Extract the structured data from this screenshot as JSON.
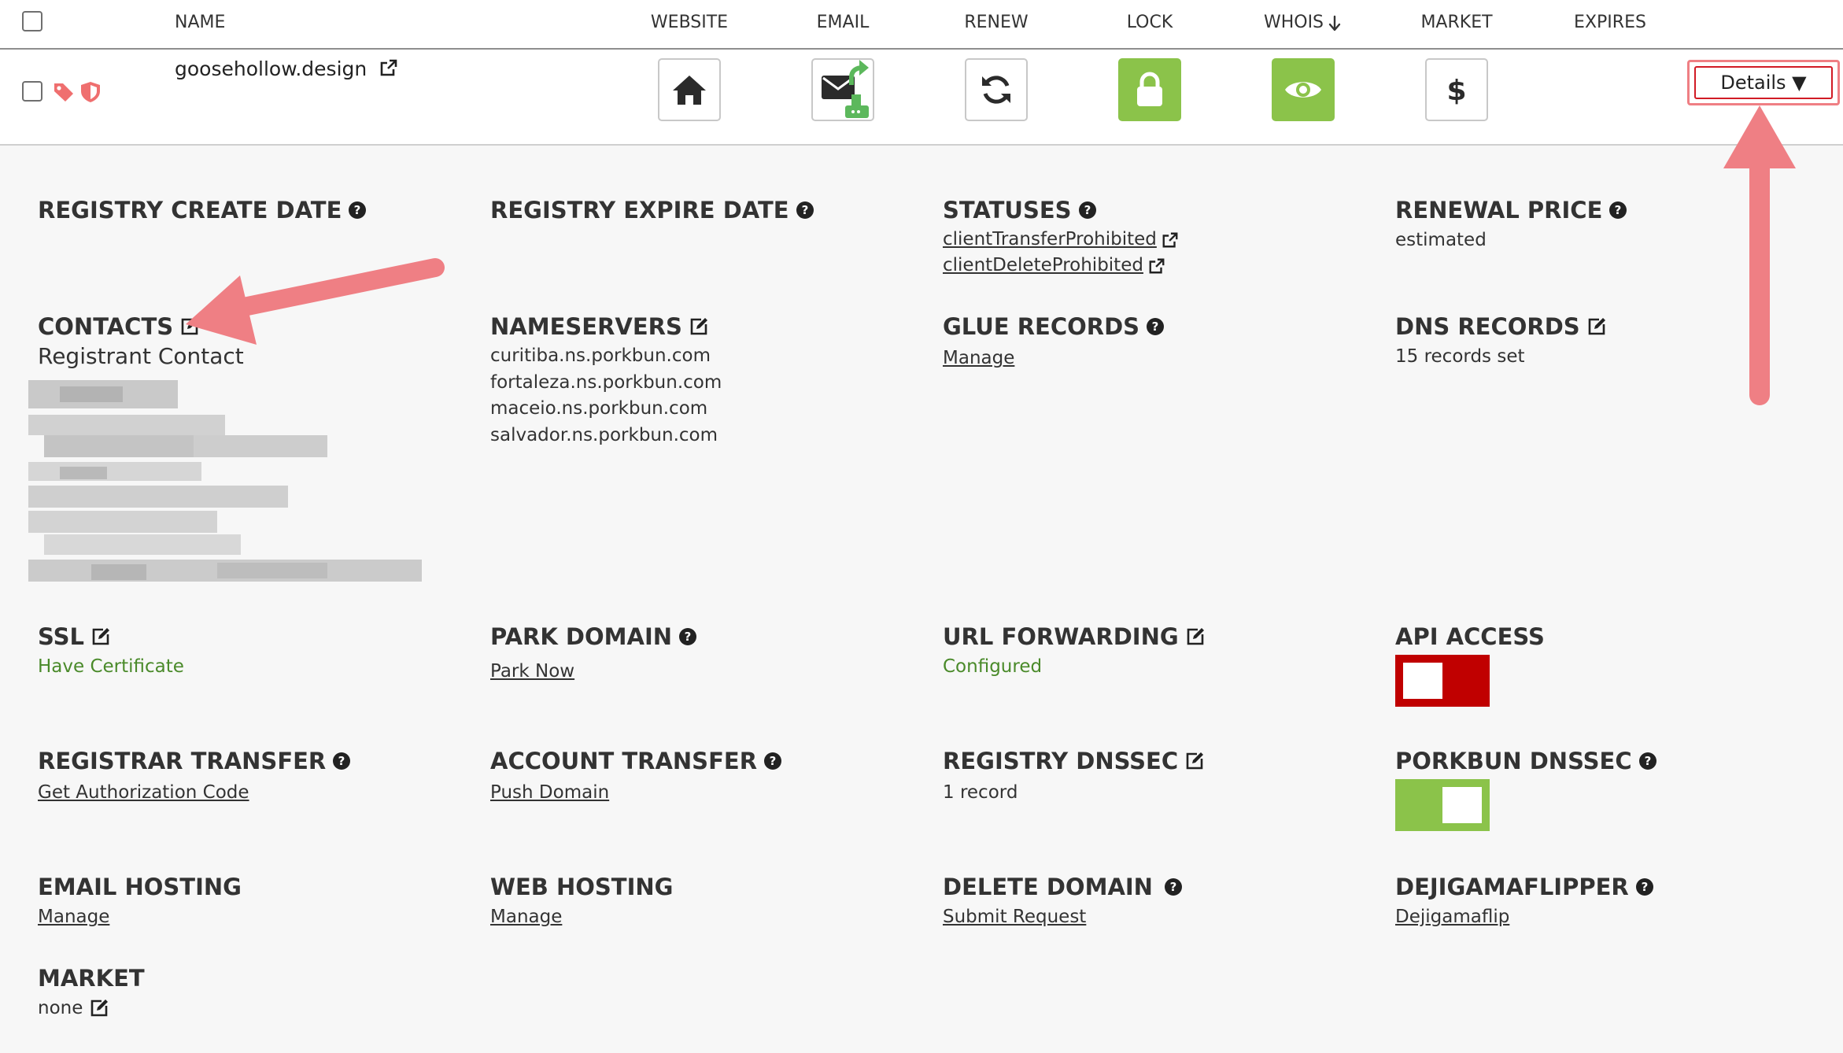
{
  "header": {
    "columns": [
      "NAME",
      "WEBSITE",
      "EMAIL",
      "RENEW",
      "LOCK",
      "WHOIS",
      "MARKET",
      "EXPIRES"
    ],
    "whois_sort_icon": "arrow-down-icon"
  },
  "row": {
    "domain": "goosehollow.design",
    "tag_icons": [
      "tag-icon",
      "shield-icon"
    ],
    "actions": [
      {
        "name": "website",
        "icon": "home-icon"
      },
      {
        "name": "email",
        "icon": "email-forward-icon"
      },
      {
        "name": "renew",
        "icon": "refresh-icon"
      },
      {
        "name": "lock",
        "icon": "lock-icon",
        "color": "#8bc34a"
      },
      {
        "name": "whois",
        "icon": "eye-icon",
        "color": "#8bc34a"
      },
      {
        "name": "market",
        "icon": "dollar-icon"
      }
    ],
    "details_label": "Details ▼"
  },
  "details": {
    "registry_create_date": {
      "label": "REGISTRY CREATE DATE"
    },
    "registry_expire_date": {
      "label": "REGISTRY EXPIRE DATE"
    },
    "statuses": {
      "label": "STATUSES",
      "values": [
        "clientTransferProhibited",
        "clientDeleteProhibited"
      ]
    },
    "renewal_price": {
      "label": "RENEWAL PRICE",
      "value": "estimated"
    },
    "contacts": {
      "label": "CONTACTS",
      "value": "Registrant Contact"
    },
    "nameservers": {
      "label": "NAMESERVERS",
      "values": [
        "curitiba.ns.porkbun.com",
        "fortaleza.ns.porkbun.com",
        "maceio.ns.porkbun.com",
        "salvador.ns.porkbun.com"
      ]
    },
    "glue_records": {
      "label": "GLUE RECORDS",
      "value": "Manage"
    },
    "dns_records": {
      "label": "DNS RECORDS",
      "value": "15 records set"
    },
    "ssl": {
      "label": "SSL",
      "value": "Have Certificate"
    },
    "park_domain": {
      "label": "PARK DOMAIN",
      "value": "Park Now"
    },
    "url_forwarding": {
      "label": "URL FORWARDING",
      "value": "Configured"
    },
    "api_access": {
      "label": "API ACCESS",
      "enabled": false,
      "color": "#c00000"
    },
    "registrar_transfer": {
      "label": "REGISTRAR TRANSFER",
      "value": "Get Authorization Code"
    },
    "account_transfer": {
      "label": "ACCOUNT TRANSFER",
      "value": "Push Domain"
    },
    "registry_dnssec": {
      "label": "REGISTRY DNSSEC",
      "value": "1 record"
    },
    "porkbun_dnssec": {
      "label": "PORKBUN DNSSEC",
      "enabled": true,
      "color": "#8bc34a"
    },
    "email_hosting": {
      "label": "EMAIL HOSTING",
      "value": "Manage"
    },
    "web_hosting": {
      "label": "WEB HOSTING",
      "value": "Manage"
    },
    "delete_domain": {
      "label": "DELETE DOMAIN",
      "value": "Submit Request"
    },
    "dejigamaflipper": {
      "label": "DEJIGAMAFLIPPER",
      "value": "Dejigamaflip"
    },
    "market": {
      "label": "MARKET",
      "value": "none"
    }
  },
  "colors": {
    "accent_green": "#8bc34a",
    "danger_red": "#c00000",
    "annotation_arrow": "#ef7f84"
  }
}
